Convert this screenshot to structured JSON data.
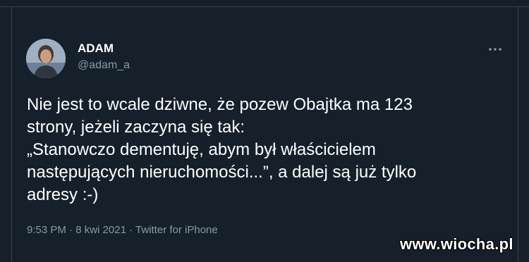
{
  "tweet": {
    "display_name": "ADAM",
    "handle": "@adam_a",
    "text": "Nie jest to wcale dziwne, że pozew Obajtka ma 123\nstrony, jeżeli zaczyna się tak:\n„Stanowczo dementuję, abym był właścicielem\nnastępujących nieruchomości...”, a dalej są już tylko\nadresy :-)",
    "time": "9:53 PM",
    "date": "8 kwi 2021",
    "source": "Twitter for iPhone",
    "separator": "·"
  },
  "watermark": "www.wiocha.pl",
  "colors": {
    "background": "#15202b",
    "secondary_text": "#8899a6",
    "border": "#38444d"
  },
  "icons": {
    "more": "more-horizontal-icon"
  }
}
